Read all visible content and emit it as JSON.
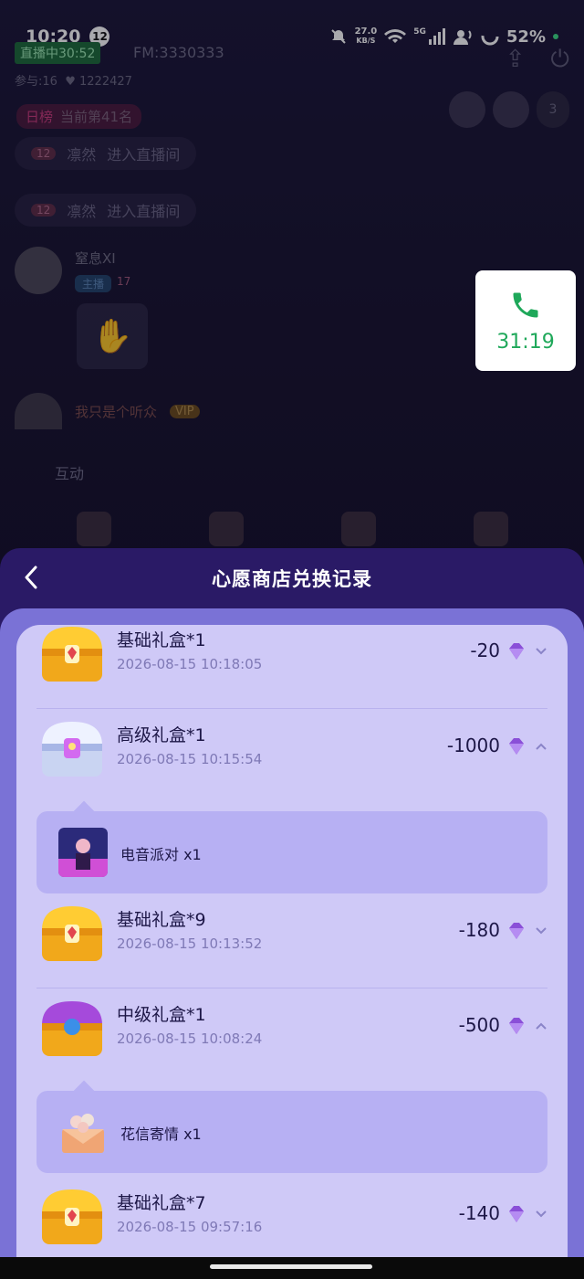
{
  "status_bar": {
    "time": "10:20",
    "notification_count": "12",
    "net_speed_value": "27.0",
    "net_speed_unit": "KB/S",
    "network_label": "5G",
    "battery": "52%"
  },
  "background_room": {
    "live_tag": "直播中30:52",
    "fm": "FM:3330333",
    "viewers": "参与:16",
    "likes": "1222427",
    "rank_tag": "日榜",
    "rank_text": "当前第41名",
    "audience_count": "3",
    "chat_items": [
      {
        "level": "12",
        "name": "凛然",
        "action": "进入直播间"
      },
      {
        "level": "12",
        "name": "凛然",
        "action": "进入直播间"
      }
    ],
    "host_name": "窒息XI",
    "host_tag": "主播",
    "host_level": "17",
    "user2_name": "我只是个听众",
    "user2_vip": "VIP",
    "interact_label": "互动"
  },
  "call_widget": {
    "timer": "31:19"
  },
  "sheet": {
    "title": "心愿商店兑换记录",
    "records": [
      {
        "name": "基础礼盒*1",
        "time": "2026-08-15 10:18:05",
        "amount": "-20",
        "chest": "gold",
        "expanded": false
      },
      {
        "name": "高级礼盒*1",
        "time": "2026-08-15 10:15:54",
        "amount": "-1000",
        "chest": "silver",
        "expanded": true,
        "reward": {
          "label": "电音派对 x1"
        }
      },
      {
        "name": "基础礼盒*9",
        "time": "2026-08-15 10:13:52",
        "amount": "-180",
        "chest": "gold",
        "expanded": false
      },
      {
        "name": "中级礼盒*1",
        "time": "2026-08-15 10:08:24",
        "amount": "-500",
        "chest": "purple",
        "expanded": true,
        "reward": {
          "label": "花信寄情 x1"
        }
      },
      {
        "name": "基础礼盒*7",
        "time": "2026-08-15 09:57:16",
        "amount": "-140",
        "chest": "gold",
        "expanded": false
      }
    ]
  },
  "colors": {
    "sheet_bg": "#2a1a66",
    "list_bg": "#cfc9f7",
    "accent_green": "#1fa85a"
  }
}
